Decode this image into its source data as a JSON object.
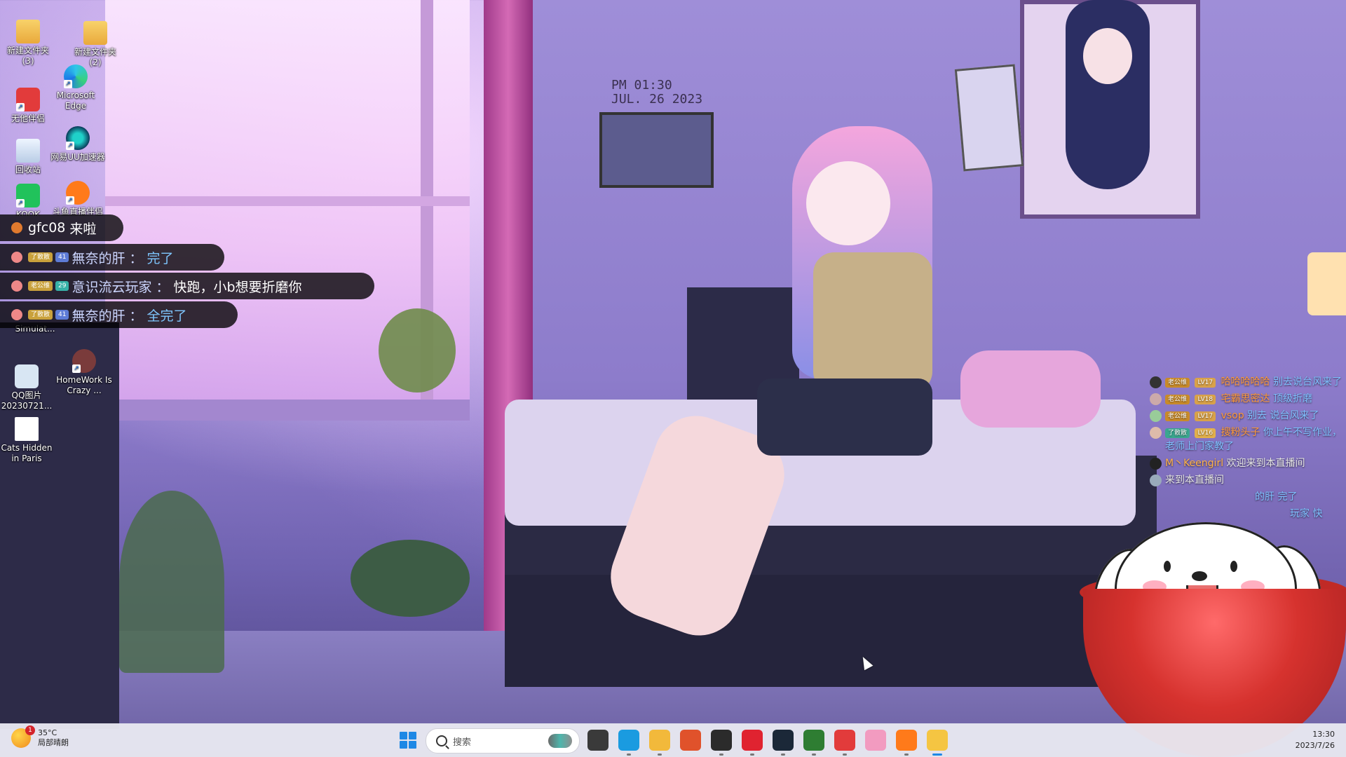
{
  "wallpaper": {
    "clock_line1": "PM 01:30",
    "clock_line2": "JUL. 26 2023"
  },
  "desktop_icons": [
    {
      "label": "新建文件夹 (3)",
      "icon": "folder-icon"
    },
    {
      "label": "新建文件夹 (2)",
      "icon": "folder-icon"
    },
    {
      "label": "无他伴侣",
      "icon": "app-icon"
    },
    {
      "label": "Microsoft Edge",
      "icon": "edge-icon"
    },
    {
      "label": "回收站",
      "icon": "recycle-bin-icon"
    },
    {
      "label": "网易UU加速器",
      "icon": "uu-icon"
    },
    {
      "label": "KOOK",
      "icon": "kook-icon"
    },
    {
      "label": "斗鱼直播伴侣",
      "icon": "douyu-icon"
    },
    {
      "label": "Simulat...",
      "icon": "app-icon"
    },
    {
      "label": "QQ图片 20230721...",
      "icon": "image-file-icon"
    },
    {
      "label": "HomeWork Is Crazy ...",
      "icon": "game-icon"
    },
    {
      "label": "Cats Hidden in Paris",
      "icon": "document-icon"
    }
  ],
  "danmaku": [
    {
      "user": "gfc08",
      "message": "来啦",
      "badge_fan": "",
      "badge_level": ""
    },
    {
      "user": "無奈的肝",
      "message": "完了",
      "badge_fan": "了散散",
      "badge_level": "41"
    },
    {
      "user": "意识流云玩家",
      "message": "快跑，小b想要折磨你",
      "badge_fan": "老公维",
      "badge_level": "29"
    },
    {
      "user": "無奈的肝",
      "message": "全完了",
      "badge_fan": "了散散",
      "badge_level": "41"
    }
  ],
  "danmaku_sep": "：",
  "chat": [
    {
      "fan": "老公维",
      "level": "LV17",
      "user": "哈哈哈哈哈",
      "message": "别去说台风来了"
    },
    {
      "fan": "老公维",
      "level": "LV18",
      "user": "宅霸思密达",
      "message": "顶级折磨"
    },
    {
      "fan": "老公维",
      "level": "LV17",
      "user": "vsop",
      "message": "别去 说台风来了"
    },
    {
      "fan": "了散散",
      "level": "LV16",
      "user": "搜粉头子",
      "message": "你上午不写作业，老师上门家教了"
    },
    {
      "fan": "",
      "level": "",
      "user": "M丶Keengirl",
      "message": "欢迎来到本直播间"
    },
    {
      "fan": "",
      "level": "",
      "user": "",
      "message": "来到本直播间"
    },
    {
      "fan": "",
      "level": "",
      "user": "",
      "message": "的肝 完了"
    },
    {
      "fan": "",
      "level": "",
      "user": "",
      "message": "玩家 快"
    }
  ],
  "taskbar": {
    "weather_temp": "35°C",
    "weather_desc": "局部晴朗",
    "weather_badge": "1",
    "search_placeholder": "搜索",
    "time": "13:30",
    "date": "2023/7/26",
    "apps": [
      {
        "icon": "task-view-icon",
        "color": "#3a3a3a"
      },
      {
        "icon": "edge-icon",
        "color": "#1a9be0"
      },
      {
        "icon": "file-explorer-icon",
        "color": "#f2b93b"
      },
      {
        "icon": "bird-app-icon",
        "color": "#e0522b"
      },
      {
        "icon": "recorder-app-icon",
        "color": "#2b2b2b"
      },
      {
        "icon": "netease-music-icon",
        "color": "#e02330"
      },
      {
        "icon": "steam-icon",
        "color": "#1b2838"
      },
      {
        "icon": "vpn-app-icon",
        "color": "#2e7d32"
      },
      {
        "icon": "wuta-app-icon",
        "color": "#e23b3b"
      },
      {
        "icon": "pink-app-icon",
        "color": "#f29bc0"
      },
      {
        "icon": "douyu-icon",
        "color": "#ff7a1a"
      },
      {
        "icon": "mascot-app-icon",
        "color": "#f5c542"
      }
    ]
  }
}
